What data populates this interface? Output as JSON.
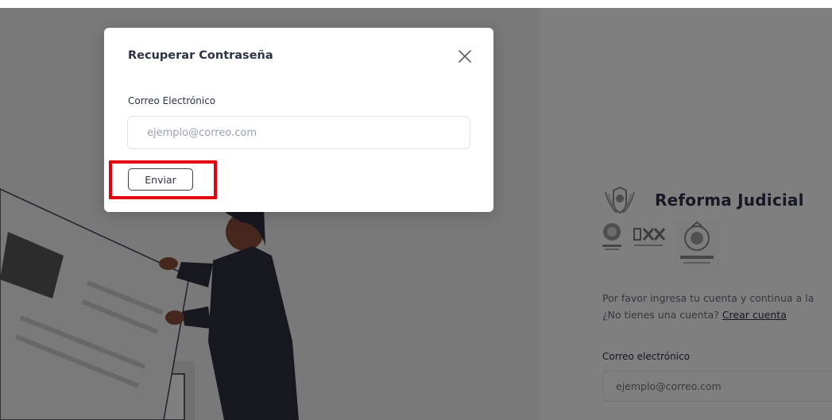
{
  "modal": {
    "title": "Recuperar Contraseña",
    "email_label": "Correo Electrónico",
    "email_placeholder": "ejemplo@correo.com",
    "email_value": "",
    "submit_label": "Enviar"
  },
  "brand": {
    "title": "Reforma Judicial"
  },
  "login": {
    "intro_text": "Por favor ingresa tu cuenta y continua a la",
    "no_account_text": "¿No tienes una cuenta? ",
    "create_account_link": "Crear cuenta",
    "email_label": "Correo electrónico",
    "email_placeholder": "ejemplo@correo.com"
  },
  "colors": {
    "highlight": "#e3000f",
    "text_dark": "#2c3347",
    "text_muted": "#6b7180",
    "illustration_dark": "#2f2e41"
  }
}
